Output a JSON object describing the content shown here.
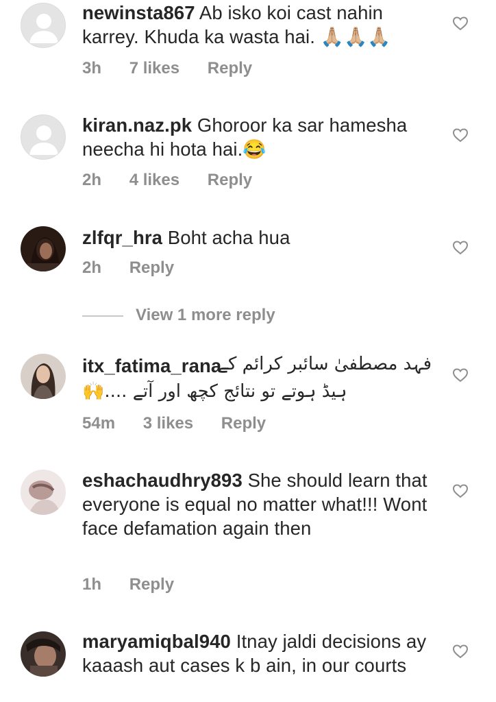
{
  "comments": [
    {
      "username": "newinsta867",
      "text": "Ab isko koi cast nahin karrey. Khuda ka wasta hai. 🙏🏼🙏🏼🙏🏼",
      "time": "3h",
      "likes": "7 likes",
      "reply": "Reply",
      "avatar": "default-avatar-icon"
    },
    {
      "username": "kiran.naz.pk",
      "text": "Ghoroor ka sar hamesha neecha hi hota hai.😂",
      "time": "2h",
      "likes": "4 likes",
      "reply": "Reply",
      "avatar": "default-avatar-icon"
    },
    {
      "username": "zlfqr_hra",
      "text": "Boht acha hua",
      "time": "2h",
      "reply": "Reply",
      "view_more": "View 1 more reply"
    },
    {
      "username": "itx_fatima_rana",
      "text_line1": "فہد مصطفیٰ سائبر کرائم کے",
      "text_line2": "ہیڈ ہوتے تو نتائج کچھ اور آتے ....🙌",
      "time": "54m",
      "likes": "3 likes",
      "reply": "Reply"
    },
    {
      "username": "eshachaudhry893",
      "text": "She should learn that everyone is equal no matter what!!! Wont face defamation again then",
      "time": "1h",
      "reply": "Reply"
    },
    {
      "username": "maryamiqbal940",
      "text": "Itnay jaldi decisions ay kaaash aut cases k b ain, in our courts"
    }
  ],
  "colors": {
    "text": "#262626",
    "meta": "#8e8e8e",
    "divider": "#c7c7c7"
  }
}
